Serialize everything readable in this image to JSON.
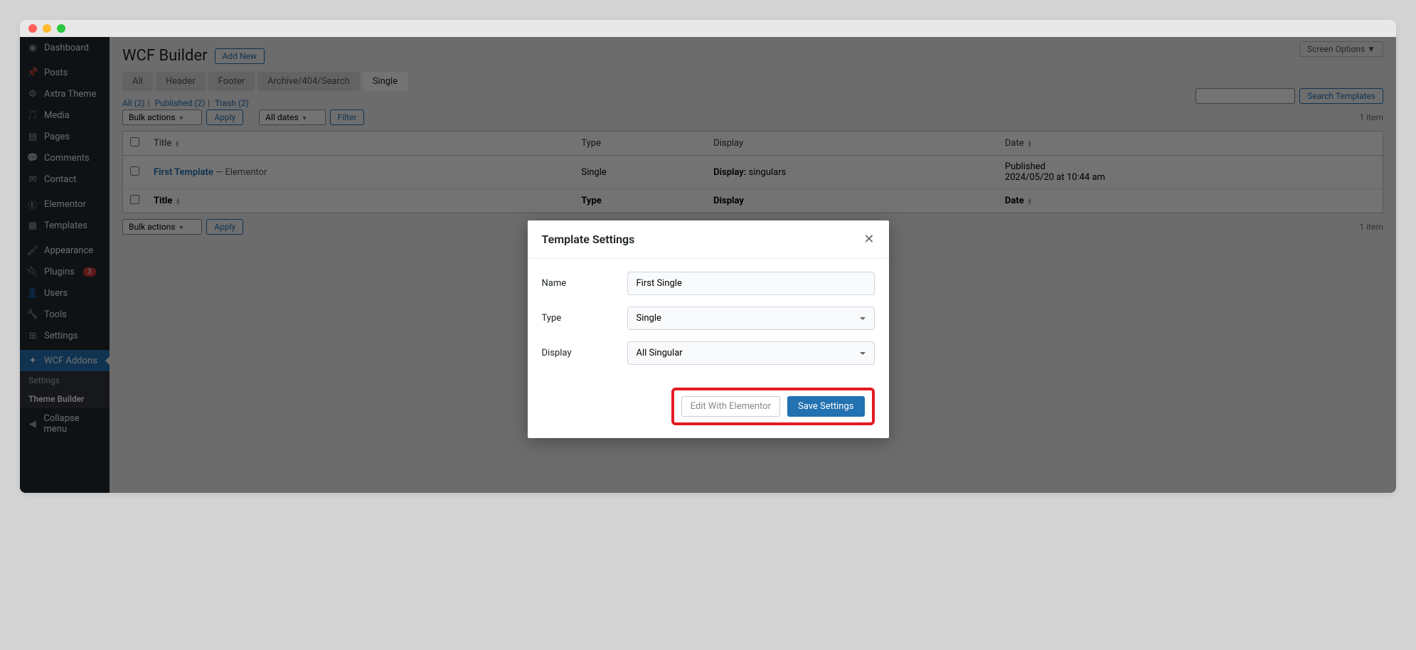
{
  "sidebar": {
    "items": [
      {
        "label": "Dashboard",
        "icon": "dashboard"
      },
      {
        "label": "Posts",
        "icon": "pin"
      },
      {
        "label": "Axtra Theme",
        "icon": "gear"
      },
      {
        "label": "Media",
        "icon": "media"
      },
      {
        "label": "Pages",
        "icon": "pages"
      },
      {
        "label": "Comments",
        "icon": "comments"
      },
      {
        "label": "Contact",
        "icon": "mail"
      },
      {
        "label": "Elementor",
        "icon": "elementor"
      },
      {
        "label": "Templates",
        "icon": "templates"
      },
      {
        "label": "Appearance",
        "icon": "brush"
      },
      {
        "label": "Plugins",
        "icon": "plug",
        "badge": "3"
      },
      {
        "label": "Users",
        "icon": "users"
      },
      {
        "label": "Tools",
        "icon": "wrench"
      },
      {
        "label": "Settings",
        "icon": "settings"
      },
      {
        "label": "WCF Addons",
        "icon": "wcf",
        "active": true
      },
      {
        "label": "Collapse menu",
        "icon": "collapse"
      }
    ],
    "submenu": [
      {
        "label": "Settings"
      },
      {
        "label": "Theme Builder",
        "active": true
      }
    ]
  },
  "header": {
    "title": "WCF Builder",
    "addNew": "Add New",
    "screenOptions": "Screen Options"
  },
  "tabs": [
    {
      "label": "All"
    },
    {
      "label": "Header"
    },
    {
      "label": "Footer"
    },
    {
      "label": "Archive/404/Search"
    },
    {
      "label": "Single",
      "active": true
    }
  ],
  "statusLinks": {
    "all": "All (2)",
    "published": "Published (2)",
    "trash": "Trash (2)"
  },
  "bulkActions": {
    "label": "Bulk actions",
    "apply": "Apply",
    "allDates": "All dates",
    "filter": "Filter"
  },
  "search": {
    "button": "Search Templates"
  },
  "itemCount": "1 item",
  "table": {
    "headers": {
      "title": "Title",
      "type": "Type",
      "display": "Display",
      "date": "Date"
    },
    "rows": [
      {
        "title": "First Template",
        "titleSuffix": " — Elementor",
        "type": "Single",
        "displayLabel": "Display:",
        "displayValue": " singulars",
        "dateStatus": "Published",
        "dateValue": "2024/05/20 at 10:44 am"
      }
    ]
  },
  "modal": {
    "title": "Template Settings",
    "nameLabel": "Name",
    "nameValue": "First Single",
    "typeLabel": "Type",
    "typeValue": "Single",
    "displayLabel": "Display",
    "displayValue": "All Singular",
    "editButton": "Edit With Elementor",
    "saveButton": "Save Settings"
  }
}
